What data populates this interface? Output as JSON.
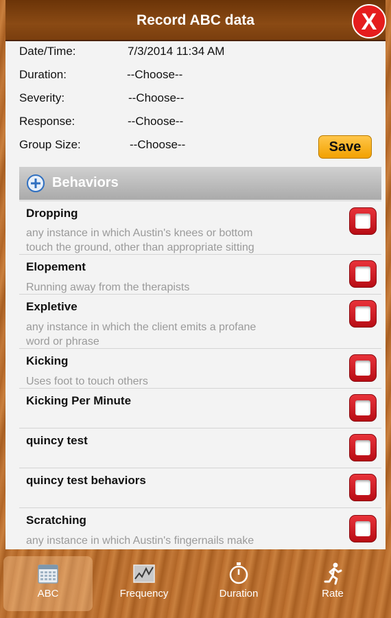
{
  "dialog": {
    "title": "Record ABC data",
    "close_label": "X",
    "save_label": "Save"
  },
  "fields": [
    {
      "label": "Date/Time:",
      "value": "7/3/2014 11:34 AM"
    },
    {
      "label": "Duration:",
      "value": "--Choose--"
    },
    {
      "label": "Severity:",
      "value": "--Choose--"
    },
    {
      "label": "Response:",
      "value": "--Choose--"
    },
    {
      "label": "Group Size:",
      "value": "--Choose--"
    }
  ],
  "behaviors": {
    "header": "Behaviors",
    "items": [
      {
        "name": "Dropping",
        "desc1": "any instance in which Austin's knees or bottom",
        "desc2": "touch the ground, other than appropriate sitting"
      },
      {
        "name": "Elopement",
        "desc1": "Running away from the therapists",
        "desc2": ""
      },
      {
        "name": "Expletive",
        "desc1": "any instance in which the client emits a profane",
        "desc2": "word or phrase"
      },
      {
        "name": "Kicking",
        "desc1": "Uses foot to touch others",
        "desc2": ""
      },
      {
        "name": "Kicking Per Minute",
        "desc1": "",
        "desc2": ""
      },
      {
        "name": "quincy test",
        "desc1": "",
        "desc2": ""
      },
      {
        "name": "quincy test behaviors",
        "desc1": "",
        "desc2": ""
      },
      {
        "name": "Scratching",
        "desc1": "any instance in which Austin's fingernails make",
        "desc2": ""
      }
    ]
  },
  "tabs": [
    {
      "label": "ABC",
      "icon": "calendar-icon",
      "active": true
    },
    {
      "label": "Frequency",
      "icon": "chart-icon",
      "active": false
    },
    {
      "label": "Duration",
      "icon": "stopwatch-icon",
      "active": false
    },
    {
      "label": "Rate",
      "icon": "runner-icon",
      "active": false
    }
  ],
  "colors": {
    "close": "#e51d1d",
    "save": "#f2a100",
    "checkbox": "#c8121b",
    "title_bar": "#7a3e0e"
  }
}
